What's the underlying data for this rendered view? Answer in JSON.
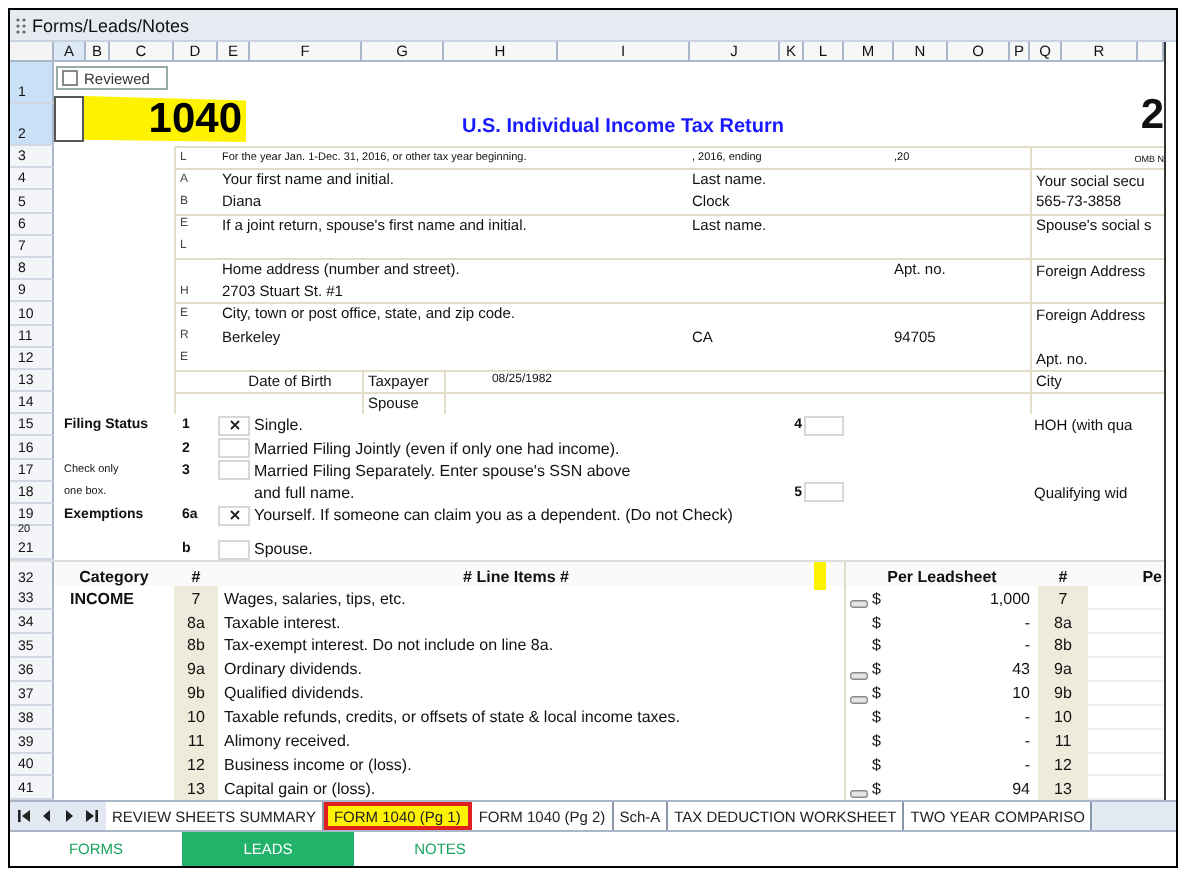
{
  "window": {
    "title": "Forms/Leads/Notes"
  },
  "columns": [
    {
      "label": "A",
      "selected": true
    },
    {
      "label": "B",
      "selected": false
    },
    {
      "label": "C",
      "selected": false
    },
    {
      "label": "D",
      "selected": false
    },
    {
      "label": "E",
      "selected": false
    },
    {
      "label": "F",
      "selected": false
    },
    {
      "label": "G",
      "selected": false
    },
    {
      "label": "H",
      "selected": false
    },
    {
      "label": "I",
      "selected": false
    },
    {
      "label": "J",
      "selected": false
    },
    {
      "label": "K",
      "selected": false
    },
    {
      "label": "L",
      "selected": false
    },
    {
      "label": "M",
      "selected": false
    },
    {
      "label": "N",
      "selected": false
    },
    {
      "label": "O",
      "selected": false
    },
    {
      "label": "P",
      "selected": false
    },
    {
      "label": "Q",
      "selected": false
    },
    {
      "label": "R",
      "selected": false
    }
  ],
  "reviewed": {
    "label": "Reviewed",
    "checked": false
  },
  "form": {
    "rows": [
      {
        "row": "1",
        "selected": true
      },
      {
        "row": "2",
        "selected": true
      }
    ],
    "number": "1040",
    "title": "U.S. Individual Income Tax Return",
    "corner": "2"
  },
  "identity": [
    {
      "row": "3",
      "selected": false,
      "kind": "line",
      "code": "L",
      "left": "For the year Jan. 1-Dec. 31, 2016, or other tax year beginning.",
      "middle": ", 2016, ending",
      "aside": ",20",
      "right": "OMB N"
    },
    {
      "row": "4",
      "selected": false,
      "kind": "line",
      "code": "A",
      "left": "Your first name and initial.",
      "middle": "Last name.",
      "right": "Your social secu"
    },
    {
      "row": "5",
      "selected": false,
      "kind": "line",
      "code": "B",
      "left": "Diana",
      "middle": "Clock",
      "right": "565-73-3858"
    },
    {
      "row": "6",
      "selected": false,
      "kind": "line",
      "code": "E",
      "left": "If a joint return, spouse's first name and initial.",
      "middle": "Last name.",
      "right": "Spouse's social s"
    },
    {
      "row": "7",
      "selected": false,
      "kind": "line",
      "code": "L"
    },
    {
      "row": "8",
      "selected": false,
      "kind": "line",
      "left": "Home address (number and street).",
      "aside": "Apt. no.",
      "right": "Foreign Address"
    },
    {
      "row": "9",
      "selected": false,
      "kind": "line",
      "code": "H",
      "left": "2703 Stuart St. #1"
    },
    {
      "row": "10",
      "selected": false,
      "kind": "line",
      "code": "E",
      "left": "City, town or post office, state, and zip code.",
      "right": "Foreign Address"
    },
    {
      "row": "11",
      "selected": false,
      "kind": "line",
      "code": "R",
      "left": "Berkeley",
      "middle": "CA",
      "aside": "94705"
    },
    {
      "row": "12",
      "selected": false,
      "kind": "line",
      "code": "E",
      "right": "Apt. no."
    },
    {
      "row": "13",
      "selected": false,
      "kind": "dob",
      "label": "Date of Birth",
      "who": "Taxpayer",
      "value": "08/25/1982",
      "right": "City"
    },
    {
      "row": "14",
      "selected": false,
      "kind": "dob",
      "who": "Spouse"
    }
  ],
  "filing": [
    {
      "row": "15",
      "selected": false,
      "heading": "Filing Status",
      "number": "1",
      "checked": true,
      "text": "Single.",
      "alt_number": "4",
      "alt_checked": false,
      "alt_text": "HOH (with qua"
    },
    {
      "row": "16",
      "selected": false,
      "number": "2",
      "checked": false,
      "text": "Married Filing Jointly (even if only one had income)."
    },
    {
      "row": "17",
      "selected": false,
      "note": "Check only",
      "number": "3",
      "checked": false,
      "text": "Married Filing Separately. Enter spouse's SSN above"
    },
    {
      "row": "18",
      "selected": false,
      "note": "one box.",
      "text": "and full name.",
      "alt_number": "5",
      "alt_checked": false,
      "alt_text": "Qualifying wid"
    },
    {
      "row": "19",
      "selected": false,
      "heading": "Exemptions",
      "number": "6a",
      "checked": true,
      "text": "Yourself. If someone can claim you as a dependent. (Do not Check)"
    },
    {
      "row": "20",
      "selected": false
    },
    {
      "row": "21",
      "selected": false,
      "number": "b",
      "checked": false,
      "text": "Spouse."
    }
  ],
  "income": {
    "row": "32",
    "selected": false,
    "headers": {
      "category": "Category",
      "number": "#",
      "items": "# Line Items #",
      "per": "Per Leadsheet",
      "ref": "#",
      "next": "Pe"
    },
    "lines": [
      {
        "row": "33",
        "selected": false,
        "category": "INCOME",
        "number": "7",
        "text": "Wages, salaries, tips, etc.",
        "note": true,
        "currency": "$",
        "amount": "1,000",
        "ref": "7"
      },
      {
        "row": "34",
        "selected": false,
        "number": "8a",
        "text": "Taxable interest.",
        "note": false,
        "currency": "$",
        "amount": "-",
        "ref": "8a"
      },
      {
        "row": "35",
        "selected": false,
        "number": "8b",
        "text": "Tax-exempt interest. Do not include on line 8a.",
        "note": false,
        "currency": "$",
        "amount": "-",
        "ref": "8b"
      },
      {
        "row": "36",
        "selected": false,
        "number": "9a",
        "text": "Ordinary dividends.",
        "note": true,
        "currency": "$",
        "amount": "43",
        "ref": "9a"
      },
      {
        "row": "37",
        "selected": false,
        "number": "9b",
        "text": "Qualified dividends.",
        "note": true,
        "currency": "$",
        "amount": "10",
        "ref": "9b"
      },
      {
        "row": "38",
        "selected": false,
        "number": "10",
        "text": "Taxable refunds, credits, or offsets of state & local income taxes.",
        "note": false,
        "currency": "$",
        "amount": "-",
        "ref": "10"
      },
      {
        "row": "39",
        "selected": false,
        "number": "11",
        "text": "Alimony received.",
        "note": false,
        "currency": "$",
        "amount": "-",
        "ref": "11"
      },
      {
        "row": "40",
        "selected": false,
        "number": "12",
        "text": "Business income or (loss).",
        "note": false,
        "currency": "$",
        "amount": "-",
        "ref": "12"
      },
      {
        "row": "41",
        "selected": false,
        "number": "13",
        "text": "Capital gain or (loss).",
        "note": true,
        "currency": "$",
        "amount": "94",
        "ref": "13"
      }
    ]
  },
  "sheet_tabs": [
    {
      "label": "REVIEW SHEETS SUMMARY",
      "selected": false
    },
    {
      "label": "FORM 1040 (Pg 1)",
      "selected": true
    },
    {
      "label": "FORM 1040 (Pg 2)",
      "selected": false
    },
    {
      "label": "Sch-A",
      "selected": false
    },
    {
      "label": "TAX DEDUCTION WORKSHEET",
      "selected": false
    },
    {
      "label": "TWO YEAR COMPARISO",
      "selected": false
    }
  ],
  "bottom_tabs": [
    {
      "label": "FORMS",
      "selected": false
    },
    {
      "label": "LEADS",
      "selected": true
    },
    {
      "label": "NOTES",
      "selected": false
    }
  ]
}
